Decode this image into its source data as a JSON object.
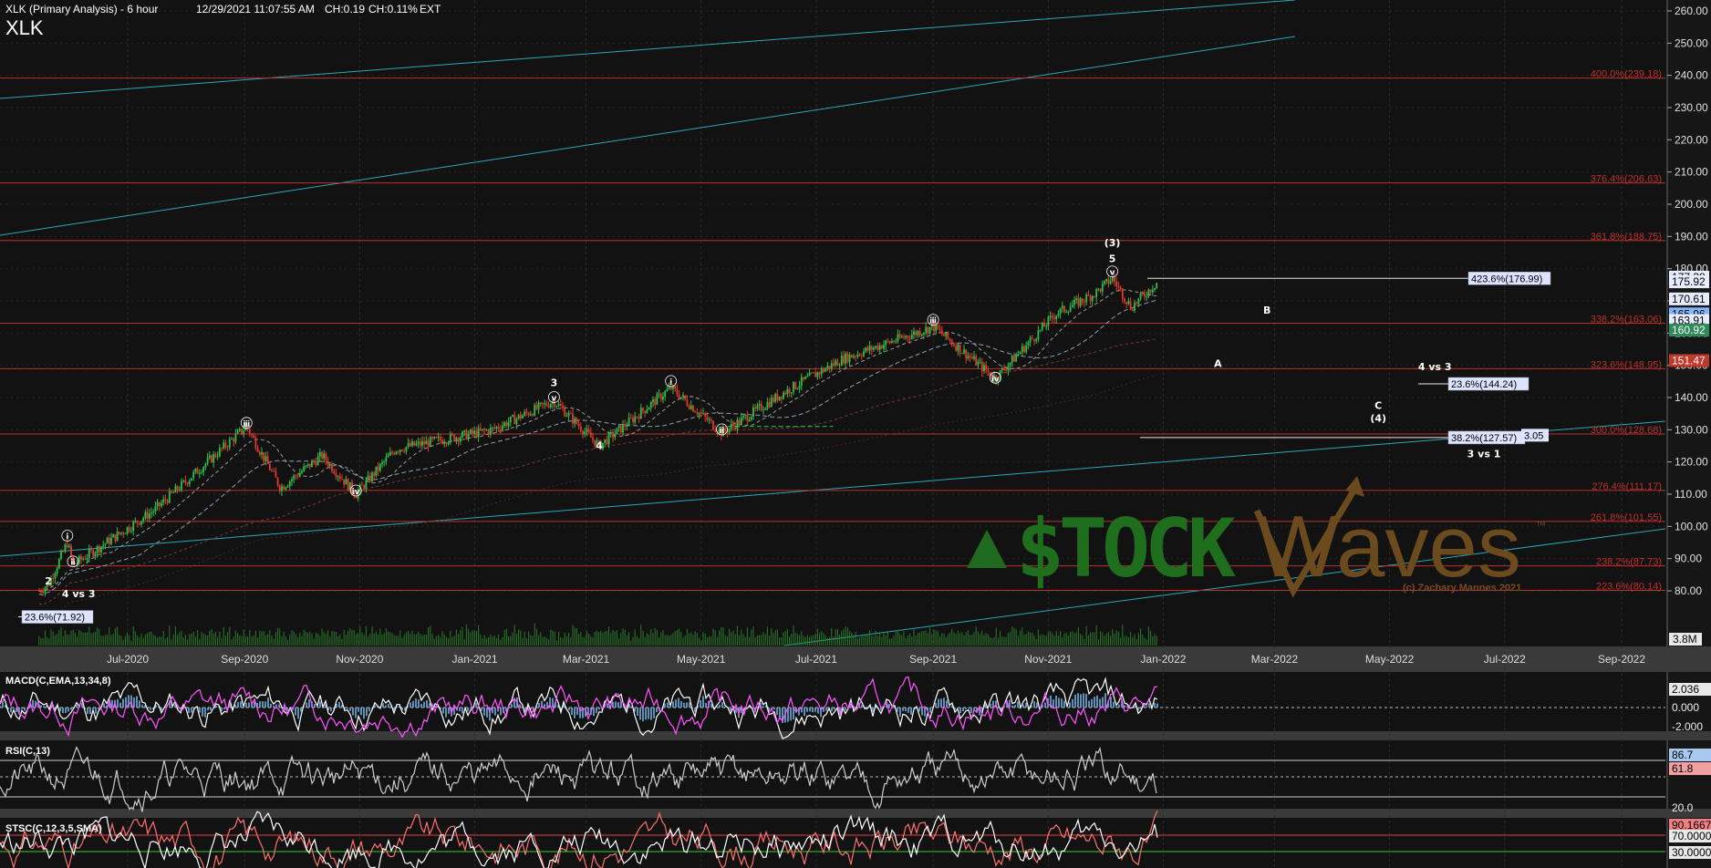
{
  "header": {
    "symbol_title": "XLK (Primary Analysis) - 6 hour",
    "timestamp": "12/29/2021 11:07:55 AM",
    "change1": "CH:0.19",
    "change2": "CH:0.11%",
    "session": "EXT",
    "symbol": "XLK"
  },
  "price_axis": {
    "ticks": [
      "260.00",
      "250.00",
      "240.00",
      "230.00",
      "220.00",
      "210.00",
      "200.00",
      "190.00",
      "180.00",
      "170.00",
      "160.00",
      "150.00",
      "140.00",
      "130.00",
      "120.00",
      "110.00",
      "100.00",
      "90.00",
      "80.00"
    ],
    "tick_values": [
      260,
      250,
      240,
      230,
      220,
      210,
      200,
      190,
      180,
      170,
      160,
      150,
      140,
      130,
      120,
      110,
      100,
      90,
      80
    ],
    "volume_label": "3.8M",
    "price_tags": [
      {
        "text": "177.38",
        "value": 177.38,
        "bg": "#e8ecff",
        "fg": "#000"
      },
      {
        "text": "175.92",
        "value": 175.92,
        "bg": "#e8ecff",
        "fg": "#000"
      },
      {
        "text": "170.61",
        "value": 170.61,
        "bg": "#e8ecff",
        "fg": "#000"
      },
      {
        "text": "165.96",
        "value": 165.96,
        "bg": "#7fb8ff",
        "fg": "#000"
      },
      {
        "text": "163.91",
        "value": 163.91,
        "bg": "#e8ecff",
        "fg": "#000"
      },
      {
        "text": "160.92",
        "value": 160.92,
        "bg": "#2e8b57",
        "fg": "#fff"
      },
      {
        "text": "151.47",
        "value": 151.47,
        "bg": "#c0392b",
        "fg": "#fff"
      }
    ]
  },
  "time_axis": [
    "Jul-2020",
    "Sep-2020",
    "Nov-2020",
    "Jan-2021",
    "Mar-2021",
    "May-2021",
    "Jul-2021",
    "Sep-2021",
    "Nov-2021",
    "Jan-2022",
    "Mar-2022",
    "May-2022",
    "Jul-2022",
    "Sep-2022"
  ],
  "fib_levels": [
    {
      "label": "400.0%(239.18)",
      "value": 239.18
    },
    {
      "label": "376.4%(206.63)",
      "value": 206.63
    },
    {
      "label": "361.8%(188.75)",
      "value": 188.75
    },
    {
      "label": "338.2%(163.06)",
      "value": 163.06
    },
    {
      "label": "323.6%(148.95)",
      "value": 148.95
    },
    {
      "label": "300.0%(128.68)",
      "value": 128.68
    },
    {
      "label": "276.4%(111.17)",
      "value": 111.17
    },
    {
      "label": "261.8%(101.55)",
      "value": 101.55
    },
    {
      "label": "238.2%(87.73)",
      "value": 87.73
    },
    {
      "label": "223.6%(80.14)",
      "value": 80.14
    }
  ],
  "target_boxes": [
    {
      "label": "423.6%(176.99)",
      "value": 176.99
    },
    {
      "label": "23.6%(144.24)",
      "value": 144.24
    },
    {
      "label": "38.2%(127.57)",
      "value": 127.57
    },
    {
      "label": "3.05",
      "value": 128.3
    },
    {
      "label": "23.6%(71.92)",
      "value": 71.92
    }
  ],
  "wave_labels": [
    {
      "text": "2",
      "date": "2020-05-20",
      "price": 82
    },
    {
      "text": "ⅰ",
      "date": "2020-05-30",
      "price": 96
    },
    {
      "text": "ⅱ",
      "date": "2020-06-02",
      "price": 88
    },
    {
      "text": "ⅲ",
      "date": "2020-09-02",
      "price": 131
    },
    {
      "text": "ⅳ",
      "date": "2020-10-30",
      "price": 110
    },
    {
      "text": "3",
      "date": "2021-02-12",
      "price": 143.5
    },
    {
      "text": "ⅴ",
      "date": "2021-02-12",
      "price": 139
    },
    {
      "text": "4",
      "date": "2021-03-08",
      "price": 124
    },
    {
      "text": "ⅰ",
      "date": "2021-04-15",
      "price": 144
    },
    {
      "text": "ⅱ",
      "date": "2021-05-12",
      "price": 129
    },
    {
      "text": "ⅲ",
      "date": "2021-09-01",
      "price": 163
    },
    {
      "text": "ⅳ",
      "date": "2021-10-04",
      "price": 145
    },
    {
      "text": "(3)",
      "date": "2021-12-05",
      "price": 187
    },
    {
      "text": "5",
      "date": "2021-12-05",
      "price": 182
    },
    {
      "text": "ⅴ",
      "date": "2021-12-05",
      "price": 178
    },
    {
      "text": "B",
      "date": "2022-02-25",
      "price": 166
    },
    {
      "text": "A",
      "date": "2022-01-30",
      "price": 149.5
    },
    {
      "text": "4 vs 3",
      "date": "2022-05-25",
      "price": 148.5
    },
    {
      "text": "C",
      "date": "2022-04-25",
      "price": 136.5
    },
    {
      "text": "(4)",
      "date": "2022-04-25",
      "price": 132.5
    },
    {
      "text": "3 vs 1",
      "date": "2022-06-20",
      "price": 121.5
    },
    {
      "text": "4 vs 3",
      "date": "2020-06-05",
      "price": 78
    }
  ],
  "macd": {
    "title": "MACD(C,EMA,13,34,8)",
    "tags": [
      "2.036",
      "0.000",
      "-2.000"
    ]
  },
  "rsi": {
    "title": "RSI(C,13)",
    "tags": [
      "86.7",
      "61.8",
      "20.0"
    ]
  },
  "stsc": {
    "title": "STSC(C,12,3,5,SMA)",
    "tags": [
      "90.1667",
      "70.0000",
      "30.0000"
    ]
  },
  "watermark": {
    "brand_left": "$TOCK",
    "brand_right": "Waves",
    "tm": "™",
    "copyright": "(c) Zachary Mannes 2021"
  },
  "colors": {
    "fib": "#c0302a",
    "channel": "#2aa9b8",
    "up": "#2ec04a",
    "down": "#e23a2a",
    "macd": "#ff55ff",
    "rsi": "#cccccc",
    "stsc": "#ff7070",
    "target_box": "#dde4ff"
  }
}
